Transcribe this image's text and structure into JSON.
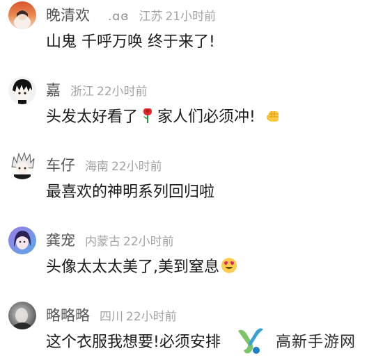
{
  "comments": [
    {
      "name": "晚清欢",
      "name_suffix": ".ɑɞ",
      "location": "江苏",
      "time": "21小时前",
      "text": "山鬼 千呼万唤 终于来了!",
      "avatar_icon": "avatar-sunset-portrait"
    },
    {
      "name": "嘉",
      "location": "浙江",
      "time": "22小时前",
      "text_before": "头发太好看了",
      "emoji_1": "rose-emoji",
      "text_after": "家人们必须冲!",
      "emoji_2": "raised-fist-emoji",
      "avatar_icon": "avatar-anime-boy"
    },
    {
      "name": "车仔",
      "location": "海南",
      "time": "22小时前",
      "text": "最喜欢的神明系列回归啦",
      "avatar_icon": "avatar-anime-white-hair"
    },
    {
      "name": "龚宠",
      "location": "内蒙古",
      "time": "22小时前",
      "text_before": "头像太太太美了,美到窒息",
      "emoji_1": "heart-eyes-emoji",
      "avatar_icon": "avatar-purple-girl"
    },
    {
      "name": "略略略",
      "location": "四川",
      "time": "22小时前",
      "text": "这个衣服我想要!必须安排",
      "avatar_icon": "avatar-dark-photo"
    }
  ],
  "watermark": {
    "text": "高新手游网",
    "logo_icon": "gaoxin-logo-icon"
  }
}
